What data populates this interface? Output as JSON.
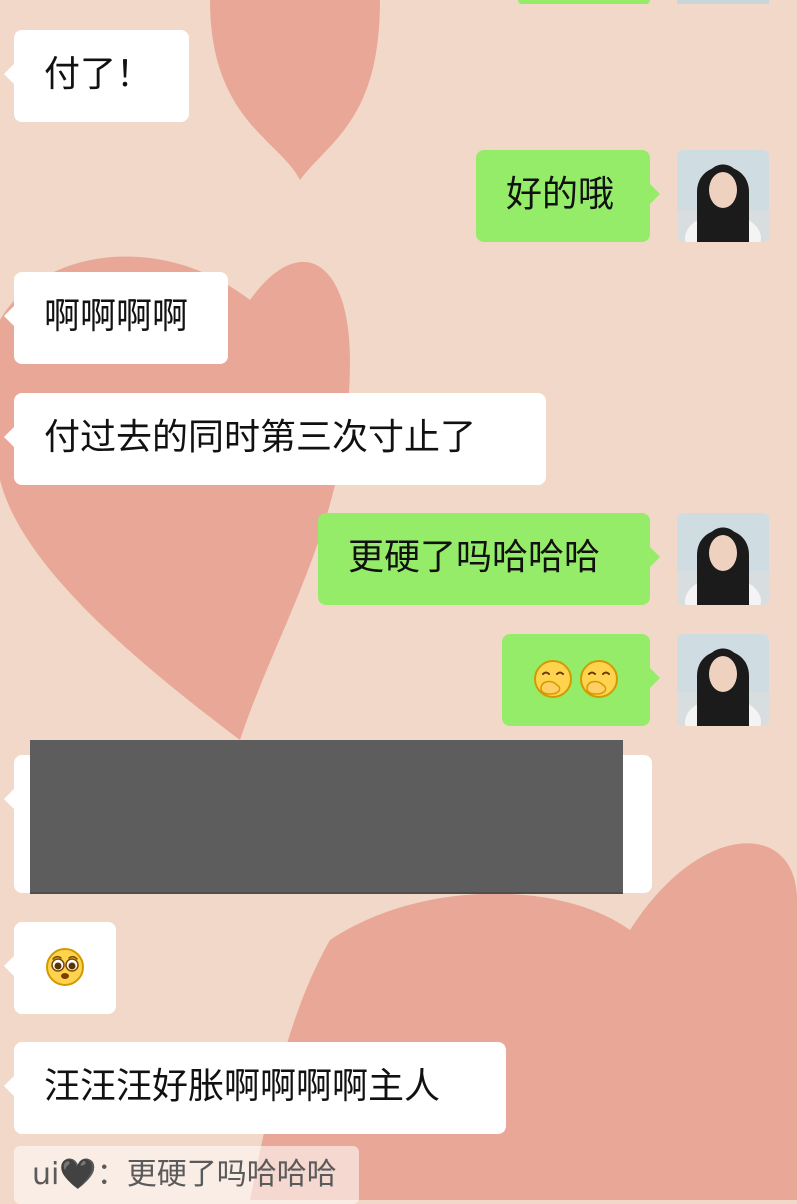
{
  "colors": {
    "background": "#f2d8c8",
    "heart": "#e7a08e",
    "incoming_bubble": "#ffffff",
    "outgoing_bubble": "#95ec69",
    "redaction": "#5d5d5d"
  },
  "messages": [
    {
      "side": "incoming",
      "text": "付了！"
    },
    {
      "side": "outgoing",
      "text": "好的哦",
      "avatar_icon": "girl-portrait-avatar"
    },
    {
      "side": "incoming",
      "text": "啊啊啊啊"
    },
    {
      "side": "incoming",
      "text": "付过去的同时第三次寸止了"
    },
    {
      "side": "outgoing",
      "text": "更硬了吗哈哈哈",
      "avatar_icon": "girl-portrait-avatar"
    },
    {
      "side": "outgoing",
      "emojis": [
        "hand-over-mouth-emoji",
        "hand-over-mouth-emoji"
      ],
      "avatar_icon": "girl-portrait-avatar"
    },
    {
      "side": "incoming",
      "content": "redacted-image"
    },
    {
      "side": "incoming",
      "emojis": [
        "pleading-face-emoji"
      ]
    },
    {
      "side": "incoming",
      "text": "汪汪汪好胀啊啊啊啊主人"
    }
  ],
  "reply_quote": {
    "sender": "ui🖤",
    "separator": "：",
    "text": "更硬了吗哈哈哈"
  }
}
